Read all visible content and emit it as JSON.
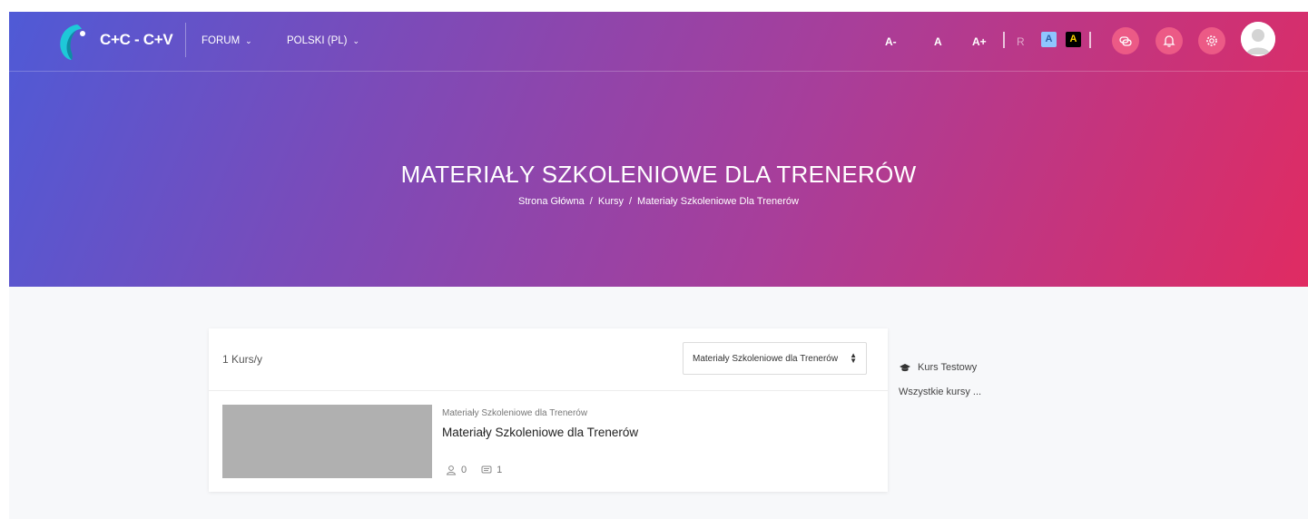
{
  "header": {
    "brand": "C+C - C+V",
    "nav": [
      {
        "label": "FORUM",
        "chevron": "chevron-down-icon"
      },
      {
        "label": "POLSKI (PL)",
        "chevron": "chevron-down-icon"
      }
    ],
    "font_size": {
      "decrease": "A-",
      "normal": "A",
      "increase": "A+"
    },
    "contrast": {
      "reset": "R",
      "blue": "A",
      "black": "A"
    },
    "icons": [
      "chat-icon",
      "bell-icon",
      "gear-icon",
      "user-avatar"
    ]
  },
  "hero": {
    "title": "MATERIAŁY SZKOLENIOWE DLA TRENERÓW",
    "breadcrumb": [
      "Strona Główna",
      "Kursy",
      "Materiały Szkoleniowe Dla Trenerów"
    ]
  },
  "courses": {
    "count_label": "1 Kurs/y",
    "category_select": "Materiały Szkoleniowe dla Trenerów",
    "items": [
      {
        "category": "Materiały Szkoleniowe dla Trenerów",
        "name": "Materiały Szkoleniowe dla Trenerów",
        "students": "0",
        "lessons": "1"
      }
    ]
  },
  "sidebar": {
    "course_link": "Kurs Testowy",
    "all_courses": "Wszystkie kursy ..."
  },
  "colors": {
    "gradient_start": "#4f5ad6",
    "gradient_end": "#e02b62",
    "icon_button": "#ec5a86"
  }
}
